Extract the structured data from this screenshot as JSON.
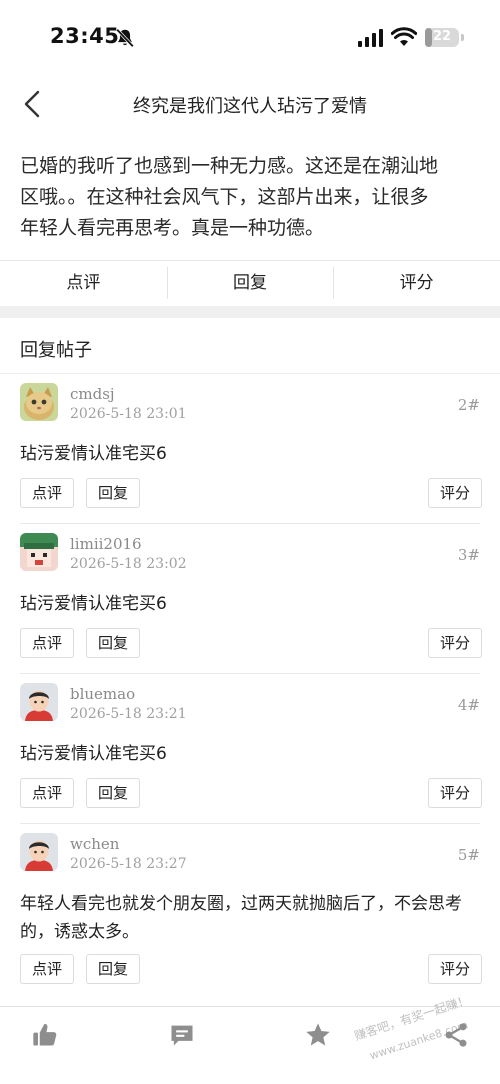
{
  "status_bar": {
    "time": "23:45",
    "battery": "22",
    "battery_level_percent": 22
  },
  "header": {
    "title": "终究是我们这代人玷污了爱情"
  },
  "article": {
    "lines": [
      "已婚的我听了也感到一种无力感。这还是在潮汕地",
      "区哦。。在这种社会风气下，这部片出来，让很多",
      "年轻人看完再思考。真是一种功德。"
    ]
  },
  "main_actions": {
    "comment": "点评",
    "reply": "回复",
    "rate": "评分"
  },
  "replies_section": {
    "title": "回复帖子"
  },
  "posts": [
    {
      "username": "cmdsj",
      "date": "2026-5-18 23:01",
      "floor": "2#",
      "body": "玷污爱情认准宅买6",
      "avatar": "cat-avatar-icon"
    },
    {
      "username": "limii2016",
      "date": "2026-5-18 23:02",
      "floor": "3#",
      "body": "玷污爱情认准宅买6",
      "avatar": "cartoon-avatar-icon"
    },
    {
      "username": "bluemao",
      "date": "2026-5-18 23:21",
      "floor": "4#",
      "body": "玷污爱情认准宅买6",
      "avatar": "person-avatar-icon"
    },
    {
      "username": "wchen",
      "date": "2026-5-18 23:27",
      "floor": "5#",
      "body": "年轻人看完也就发个朋友圈，过两天就抛脑后了，不会思考的，诱惑太多。",
      "avatar": "person-avatar-icon"
    }
  ],
  "post_buttons": {
    "comment": "点评",
    "reply": "回复",
    "rate": "评分"
  },
  "bottom_bar": {
    "icons": [
      "thumbs-up-icon",
      "message-icon",
      "star-icon",
      "share-icon"
    ]
  },
  "watermarks": {
    "bottom_line1": "赚客吧，有奖一起赚！",
    "bottom_line2": "www.zuanke8.com"
  },
  "colors": {
    "background": "#ffffff",
    "icon_gray": "#8e8e8e",
    "divider": "#e6e6e6"
  }
}
